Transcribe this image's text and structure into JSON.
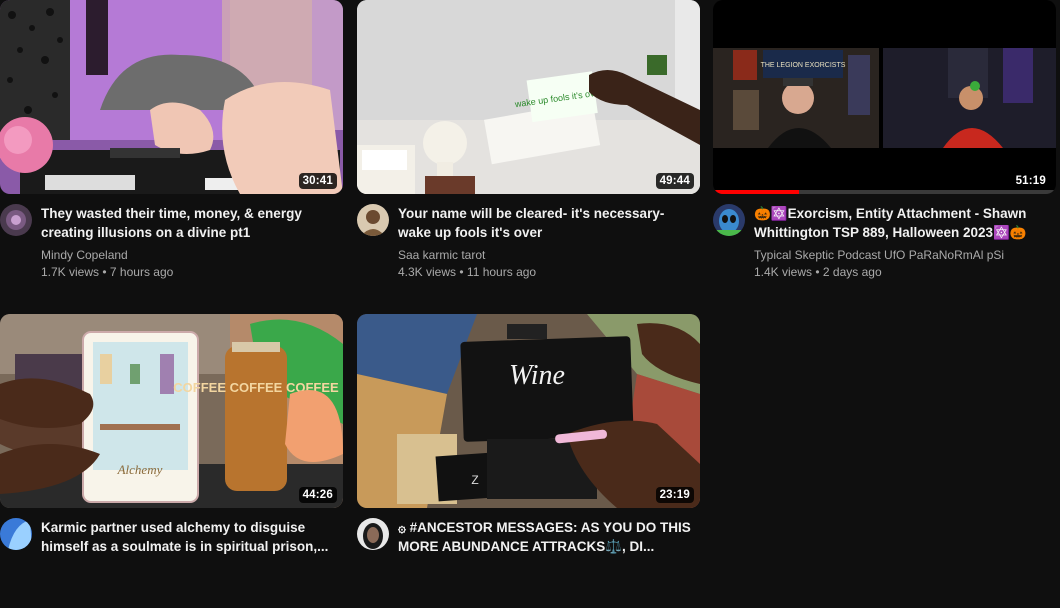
{
  "videos": [
    {
      "title": "They wasted their time, money, & energy creating illusions on a divine pt1",
      "channel": "Mindy Copeland",
      "views": "1.7K views",
      "age": "7 hours ago",
      "duration": "30:41",
      "avatar_icon": "tarot-avatar"
    },
    {
      "title": "Your name will be cleared- it's necessary- wake up fools it's over",
      "channel": "Saa karmic tarot",
      "views": "4.3K views",
      "age": "11 hours ago",
      "duration": "49:44",
      "avatar_icon": "portrait-avatar",
      "thumb_card_text": "wake up fools it's over!!!"
    },
    {
      "title": "🎃🔯Exorcism, Entity Attachment - Shawn Whittington TSP 889, Halloween 2023🔯🎃",
      "channel": "Typical Skeptic Podcast UfO PaRaNoRmAl pSi",
      "views": "1.4K views",
      "age": "2 days ago",
      "duration": "51:19",
      "watched_progress": 0.25,
      "avatar_icon": "alien-avatar",
      "thumb_poster_text": "THE LEGION EXORCISTS"
    },
    {
      "title": "Karmic partner used alchemy to disguise himself as a soulmate is in spiritual prison,...",
      "channel": "",
      "views": "",
      "age": "",
      "duration": "44:26",
      "avatar_icon": "blue-avatar",
      "thumb_card_text": "Alchemy",
      "thumb_jar_text": "COFFEE COFFEE COFFEE"
    },
    {
      "title": "۞ #ANCESTOR MESSAGES: AS YOU DO THIS MORE ABUNDANCE ATTRACKS⚖️, DI...",
      "channel": "",
      "views": "",
      "age": "",
      "duration": "23:19",
      "avatar_icon": "face-avatar",
      "thumb_card_text": "Wine"
    }
  ],
  "separator": "•"
}
